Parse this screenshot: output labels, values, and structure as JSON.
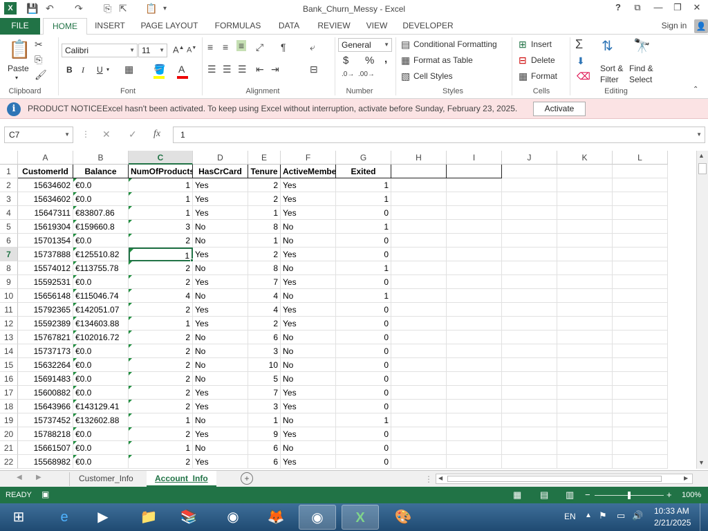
{
  "window": {
    "title": "Bank_Churn_Messy - Excel"
  },
  "ribbon_tabs": [
    "FILE",
    "HOME",
    "INSERT",
    "PAGE LAYOUT",
    "FORMULAS",
    "DATA",
    "REVIEW",
    "VIEW",
    "DEVELOPER"
  ],
  "sign_in": "Sign in",
  "ribbon": {
    "clipboard": {
      "label": "Clipboard",
      "paste": "Paste"
    },
    "font": {
      "label": "Font",
      "name": "Calibri",
      "size": "11",
      "bold": "B",
      "italic": "I",
      "underline": "U"
    },
    "alignment": {
      "label": "Alignment"
    },
    "number": {
      "label": "Number",
      "format": "General",
      "currency": "$",
      "percent": "%",
      "comma": ","
    },
    "styles": {
      "label": "Styles",
      "conditional": "Conditional Formatting",
      "format_table": "Format as Table",
      "cell_styles": "Cell Styles"
    },
    "cells": {
      "label": "Cells",
      "insert": "Insert",
      "delete": "Delete",
      "format": "Format"
    },
    "editing": {
      "label": "Editing",
      "sort": "Sort &",
      "filter": "Filter",
      "find": "Find &",
      "select": "Select"
    }
  },
  "notice": {
    "heading": "PRODUCT NOTICE",
    "message": "Excel hasn't been activated. To keep using Excel without interruption, activate before Sunday, February 23, 2025.",
    "button": "Activate"
  },
  "formula_bar": {
    "name_box": "C7",
    "cancel": "✕",
    "enter": "✓",
    "fx": "fx",
    "value": "1"
  },
  "columns": [
    "A",
    "B",
    "C",
    "D",
    "E",
    "F",
    "G",
    "H",
    "I",
    "J",
    "K",
    "L"
  ],
  "selected_column": "C",
  "selected_row": 7,
  "headers": [
    "CustomerId",
    "Balance",
    "NumOfProducts",
    "HasCrCard",
    "Tenure",
    "ActiveMember",
    "Exited"
  ],
  "rows": [
    [
      "15634602",
      "€0.0",
      "1",
      "Yes",
      "2",
      "Yes",
      "1"
    ],
    [
      "15634602",
      "€0.0",
      "1",
      "Yes",
      "2",
      "Yes",
      "1"
    ],
    [
      "15647311",
      "€83807.86",
      "1",
      "Yes",
      "1",
      "Yes",
      "0"
    ],
    [
      "15619304",
      "€159660.8",
      "3",
      "No",
      "8",
      "No",
      "1"
    ],
    [
      "15701354",
      "€0.0",
      "2",
      "No",
      "1",
      "No",
      "0"
    ],
    [
      "15737888",
      "€125510.82",
      "1",
      "Yes",
      "2",
      "Yes",
      "0"
    ],
    [
      "15574012",
      "€113755.78",
      "2",
      "No",
      "8",
      "No",
      "1"
    ],
    [
      "15592531",
      "€0.0",
      "2",
      "Yes",
      "7",
      "Yes",
      "0"
    ],
    [
      "15656148",
      "€115046.74",
      "4",
      "No",
      "4",
      "No",
      "1"
    ],
    [
      "15792365",
      "€142051.07",
      "2",
      "Yes",
      "4",
      "Yes",
      "0"
    ],
    [
      "15592389",
      "€134603.88",
      "1",
      "Yes",
      "2",
      "Yes",
      "0"
    ],
    [
      "15767821",
      "€102016.72",
      "2",
      "No",
      "6",
      "No",
      "0"
    ],
    [
      "15737173",
      "€0.0",
      "2",
      "No",
      "3",
      "No",
      "0"
    ],
    [
      "15632264",
      "€0.0",
      "2",
      "No",
      "10",
      "No",
      "0"
    ],
    [
      "15691483",
      "€0.0",
      "2",
      "No",
      "5",
      "No",
      "0"
    ],
    [
      "15600882",
      "€0.0",
      "2",
      "Yes",
      "7",
      "Yes",
      "0"
    ],
    [
      "15643966",
      "€143129.41",
      "2",
      "Yes",
      "3",
      "Yes",
      "0"
    ],
    [
      "15737452",
      "€132602.88",
      "1",
      "No",
      "1",
      "No",
      "1"
    ],
    [
      "15788218",
      "€0.0",
      "2",
      "Yes",
      "9",
      "Yes",
      "0"
    ],
    [
      "15661507",
      "€0.0",
      "1",
      "No",
      "6",
      "No",
      "0"
    ],
    [
      "15568982",
      "€0.0",
      "2",
      "Yes",
      "6",
      "Yes",
      "0"
    ]
  ],
  "sheets": [
    "Customer_Info",
    "Account_Info"
  ],
  "active_sheet": "Account_Info",
  "status": {
    "mode": "READY",
    "zoom": "100%",
    "zoom_percent": 100
  },
  "taskbar": {
    "lang": "EN",
    "time": "10:33 AM",
    "date": "2/21/2025"
  },
  "colors": {
    "excel_green": "#217346",
    "notice_bg": "#fbe3e4",
    "taskbar": "#1f4a72"
  }
}
